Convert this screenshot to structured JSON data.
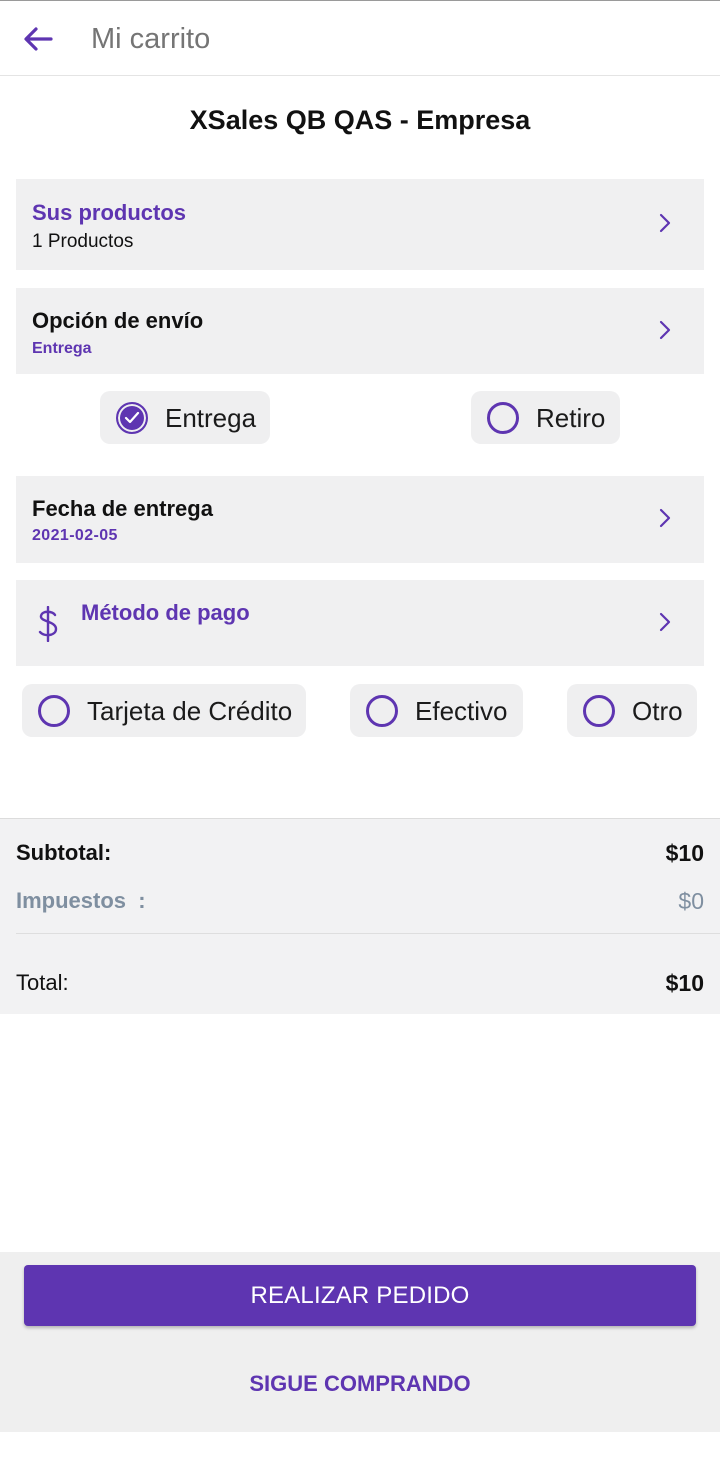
{
  "header": {
    "title": "Mi carrito",
    "back_icon": "arrow-left-icon"
  },
  "company_name": "XSales QB QAS - Empresa",
  "products": {
    "title": "Sus productos",
    "count_text": "1 Productos"
  },
  "shipping": {
    "title": "Opción de envío",
    "selected": "Entrega",
    "options": [
      {
        "label": "Entrega",
        "checked": true
      },
      {
        "label": "Retiro",
        "checked": false
      }
    ]
  },
  "delivery_date": {
    "title": "Fecha de entrega",
    "value": "2021-02-05"
  },
  "payment": {
    "title": "Método de pago",
    "icon": "dollar-icon",
    "options": [
      {
        "label": "Tarjeta de Crédito",
        "checked": false
      },
      {
        "label": "Efectivo",
        "checked": false
      },
      {
        "label": "Otro",
        "checked": false
      }
    ]
  },
  "totals": {
    "subtotal_label": "Subtotal:",
    "subtotal_value": "$10",
    "tax_label": "Impuestos  :",
    "tax_value": "$0",
    "total_label": "Total:",
    "total_value": "$10"
  },
  "actions": {
    "place_order": "REALIZAR PEDIDO",
    "continue_shopping": "SIGUE COMPRANDO"
  },
  "colors": {
    "accent": "#5e35b1",
    "muted": "#7f8fa0",
    "panel": "#f0f0f1"
  }
}
